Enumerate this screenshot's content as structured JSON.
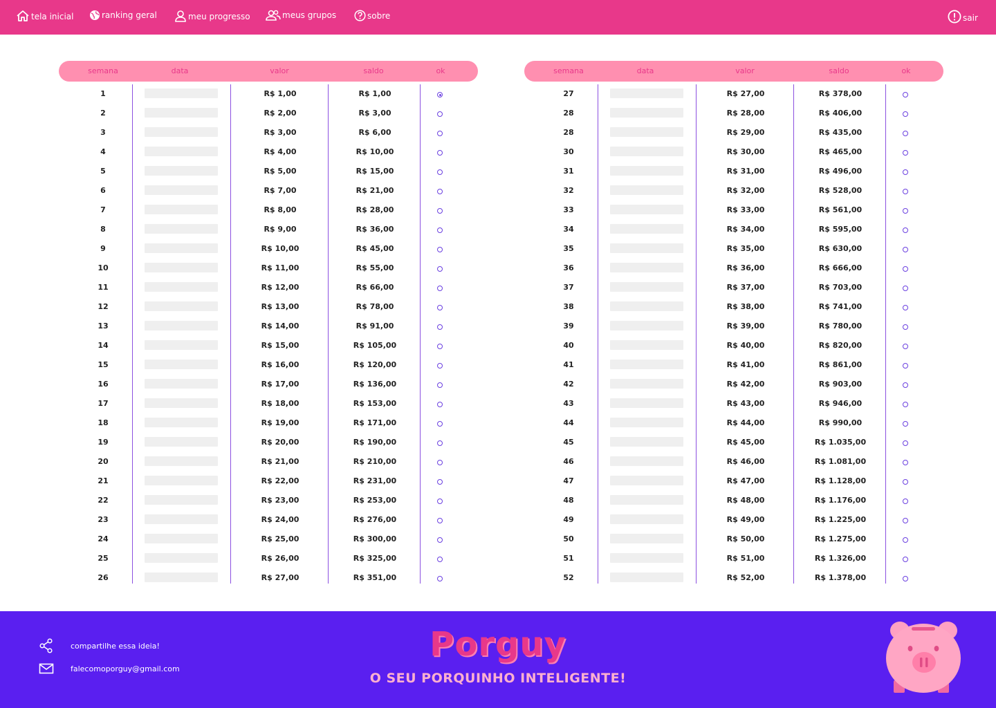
{
  "nav": {
    "items": [
      {
        "label": "tela inicial",
        "icon": "home-icon"
      },
      {
        "label": "ranking geral",
        "icon": "globe-icon"
      },
      {
        "label": "meu progresso",
        "icon": "user-icon"
      },
      {
        "label": "meus grupos",
        "icon": "group-icon"
      },
      {
        "label": "sobre",
        "icon": "help-icon"
      }
    ],
    "logout": {
      "label": "sair",
      "icon": "alert-circle-icon"
    }
  },
  "table": {
    "headers": [
      "semana",
      "data",
      "valor",
      "saldo",
      "ok"
    ],
    "left_rows": [
      {
        "semana": "1",
        "valor": "R$ 1,00",
        "saldo": "R$ 1,00",
        "ok": true
      },
      {
        "semana": "2",
        "valor": "R$ 2,00",
        "saldo": "R$ 3,00",
        "ok": false
      },
      {
        "semana": "3",
        "valor": "R$ 3,00",
        "saldo": "R$ 6,00",
        "ok": false
      },
      {
        "semana": "4",
        "valor": "R$ 4,00",
        "saldo": "R$ 10,00",
        "ok": false
      },
      {
        "semana": "5",
        "valor": "R$ 5,00",
        "saldo": "R$ 15,00",
        "ok": false
      },
      {
        "semana": "6",
        "valor": "R$ 7,00",
        "saldo": "R$ 21,00",
        "ok": false
      },
      {
        "semana": "7",
        "valor": "R$ 8,00",
        "saldo": "R$ 28,00",
        "ok": false
      },
      {
        "semana": "8",
        "valor": "R$ 9,00",
        "saldo": "R$ 36,00",
        "ok": false
      },
      {
        "semana": "9",
        "valor": "R$ 10,00",
        "saldo": "R$ 45,00",
        "ok": false
      },
      {
        "semana": "10",
        "valor": "R$ 11,00",
        "saldo": "R$ 55,00",
        "ok": false
      },
      {
        "semana": "11",
        "valor": "R$ 12,00",
        "saldo": "R$ 66,00",
        "ok": false
      },
      {
        "semana": "12",
        "valor": "R$ 13,00",
        "saldo": "R$ 78,00",
        "ok": false
      },
      {
        "semana": "13",
        "valor": "R$ 14,00",
        "saldo": "R$ 91,00",
        "ok": false
      },
      {
        "semana": "14",
        "valor": "R$ 15,00",
        "saldo": "R$ 105,00",
        "ok": false
      },
      {
        "semana": "15",
        "valor": "R$ 16,00",
        "saldo": "R$ 120,00",
        "ok": false
      },
      {
        "semana": "16",
        "valor": "R$ 17,00",
        "saldo": "R$ 136,00",
        "ok": false
      },
      {
        "semana": "17",
        "valor": "R$ 18,00",
        "saldo": "R$ 153,00",
        "ok": false
      },
      {
        "semana": "18",
        "valor": "R$ 19,00",
        "saldo": "R$ 171,00",
        "ok": false
      },
      {
        "semana": "19",
        "valor": "R$ 20,00",
        "saldo": "R$ 190,00",
        "ok": false
      },
      {
        "semana": "20",
        "valor": "R$ 21,00",
        "saldo": "R$ 210,00",
        "ok": false
      },
      {
        "semana": "21",
        "valor": "R$ 22,00",
        "saldo": "R$ 231,00",
        "ok": false
      },
      {
        "semana": "22",
        "valor": "R$ 23,00",
        "saldo": "R$ 253,00",
        "ok": false
      },
      {
        "semana": "23",
        "valor": "R$ 24,00",
        "saldo": "R$ 276,00",
        "ok": false
      },
      {
        "semana": "24",
        "valor": "R$ 25,00",
        "saldo": "R$ 300,00",
        "ok": false
      },
      {
        "semana": "25",
        "valor": "R$ 26,00",
        "saldo": "R$ 325,00",
        "ok": false
      },
      {
        "semana": "26",
        "valor": "R$ 27,00",
        "saldo": "R$ 351,00",
        "ok": false
      }
    ],
    "right_rows": [
      {
        "semana": "27",
        "valor": "R$ 27,00",
        "saldo": "R$ 378,00",
        "ok": false
      },
      {
        "semana": "28",
        "valor": "R$ 28,00",
        "saldo": "R$ 406,00",
        "ok": false
      },
      {
        "semana": "28",
        "valor": "R$ 29,00",
        "saldo": "R$ 435,00",
        "ok": false
      },
      {
        "semana": "30",
        "valor": "R$ 30,00",
        "saldo": "R$ 465,00",
        "ok": false
      },
      {
        "semana": "31",
        "valor": "R$ 31,00",
        "saldo": "R$ 496,00",
        "ok": false
      },
      {
        "semana": "32",
        "valor": "R$ 32,00",
        "saldo": "R$ 528,00",
        "ok": false
      },
      {
        "semana": "33",
        "valor": "R$ 33,00",
        "saldo": "R$ 561,00",
        "ok": false
      },
      {
        "semana": "34",
        "valor": "R$ 34,00",
        "saldo": "R$ 595,00",
        "ok": false
      },
      {
        "semana": "35",
        "valor": "R$ 35,00",
        "saldo": "R$ 630,00",
        "ok": false
      },
      {
        "semana": "36",
        "valor": "R$ 36,00",
        "saldo": "R$ 666,00",
        "ok": false
      },
      {
        "semana": "37",
        "valor": "R$ 37,00",
        "saldo": "R$ 703,00",
        "ok": false
      },
      {
        "semana": "38",
        "valor": "R$ 38,00",
        "saldo": "R$ 741,00",
        "ok": false
      },
      {
        "semana": "39",
        "valor": "R$ 39,00",
        "saldo": "R$ 780,00",
        "ok": false
      },
      {
        "semana": "40",
        "valor": "R$ 40,00",
        "saldo": "R$ 820,00",
        "ok": false
      },
      {
        "semana": "41",
        "valor": "R$ 41,00",
        "saldo": "R$ 861,00",
        "ok": false
      },
      {
        "semana": "42",
        "valor": "R$ 42,00",
        "saldo": "R$ 903,00",
        "ok": false
      },
      {
        "semana": "43",
        "valor": "R$ 43,00",
        "saldo": "R$ 946,00",
        "ok": false
      },
      {
        "semana": "44",
        "valor": "R$ 44,00",
        "saldo": "R$ 990,00",
        "ok": false
      },
      {
        "semana": "45",
        "valor": "R$ 45,00",
        "saldo": "R$ 1.035,00",
        "ok": false
      },
      {
        "semana": "46",
        "valor": "R$ 46,00",
        "saldo": "R$ 1.081,00",
        "ok": false
      },
      {
        "semana": "47",
        "valor": "R$ 47,00",
        "saldo": "R$ 1.128,00",
        "ok": false
      },
      {
        "semana": "48",
        "valor": "R$ 48,00",
        "saldo": "R$ 1.176,00",
        "ok": false
      },
      {
        "semana": "49",
        "valor": "R$ 49,00",
        "saldo": "R$ 1.225,00",
        "ok": false
      },
      {
        "semana": "50",
        "valor": "R$ 50,00",
        "saldo": "R$ 1.275,00",
        "ok": false
      },
      {
        "semana": "51",
        "valor": "R$ 51,00",
        "saldo": "R$ 1.326,00",
        "ok": false
      },
      {
        "semana": "52",
        "valor": "R$ 52,00",
        "saldo": "R$ 1.378,00",
        "ok": false
      }
    ]
  },
  "footer": {
    "share_label": "compartilhe essa ideia!",
    "email": "falecomoporguy@gmail.com",
    "brand": "Porguy",
    "tagline": "O SEU PORQUINHO INTELIGENTE!"
  },
  "colors": {
    "nav_bg": "#e8388a",
    "header_bg": "#ff8fb0",
    "accent_purple": "#5a1ff0",
    "divider": "#8b4fe0"
  }
}
